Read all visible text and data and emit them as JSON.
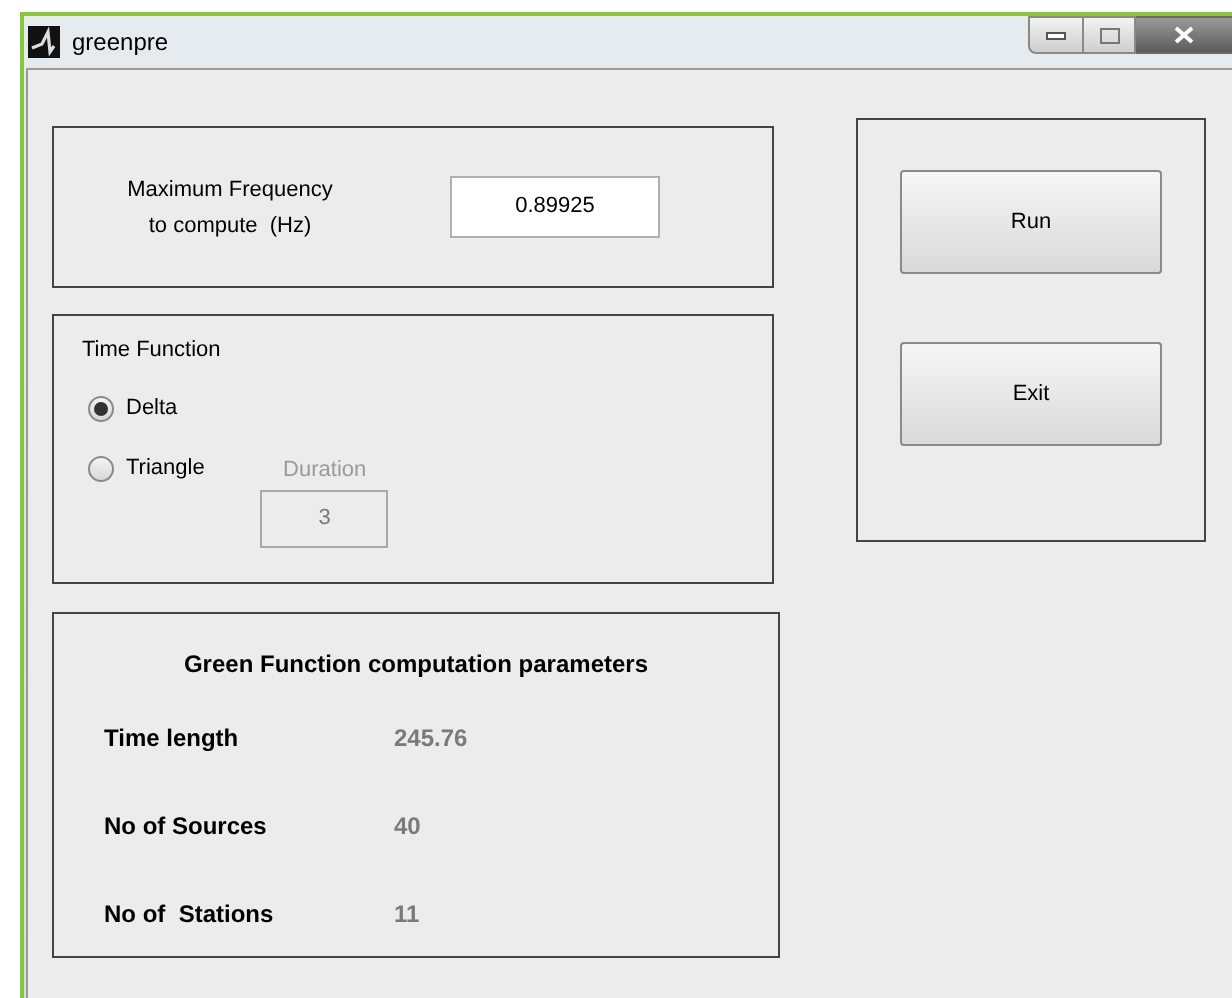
{
  "window": {
    "title": "greenpre"
  },
  "frequency": {
    "label_lines": [
      "Maximum Frequency",
      "to compute  (Hz)"
    ],
    "value": "0.89925"
  },
  "time_function": {
    "title": "Time Function",
    "options": [
      {
        "label": "Delta",
        "selected": true
      },
      {
        "label": "Triangle",
        "selected": false
      }
    ],
    "duration": {
      "label": "Duration",
      "value": "3",
      "disabled": true
    }
  },
  "parameters": {
    "title": "Green Function computation parameters",
    "rows": [
      {
        "label": "Time length",
        "value": "245.76"
      },
      {
        "label": "No of Sources",
        "value": "40"
      },
      {
        "label": "No of  Stations",
        "value": "11"
      }
    ]
  },
  "buttons": [
    {
      "label": "Run"
    },
    {
      "label": "Exit"
    }
  ]
}
